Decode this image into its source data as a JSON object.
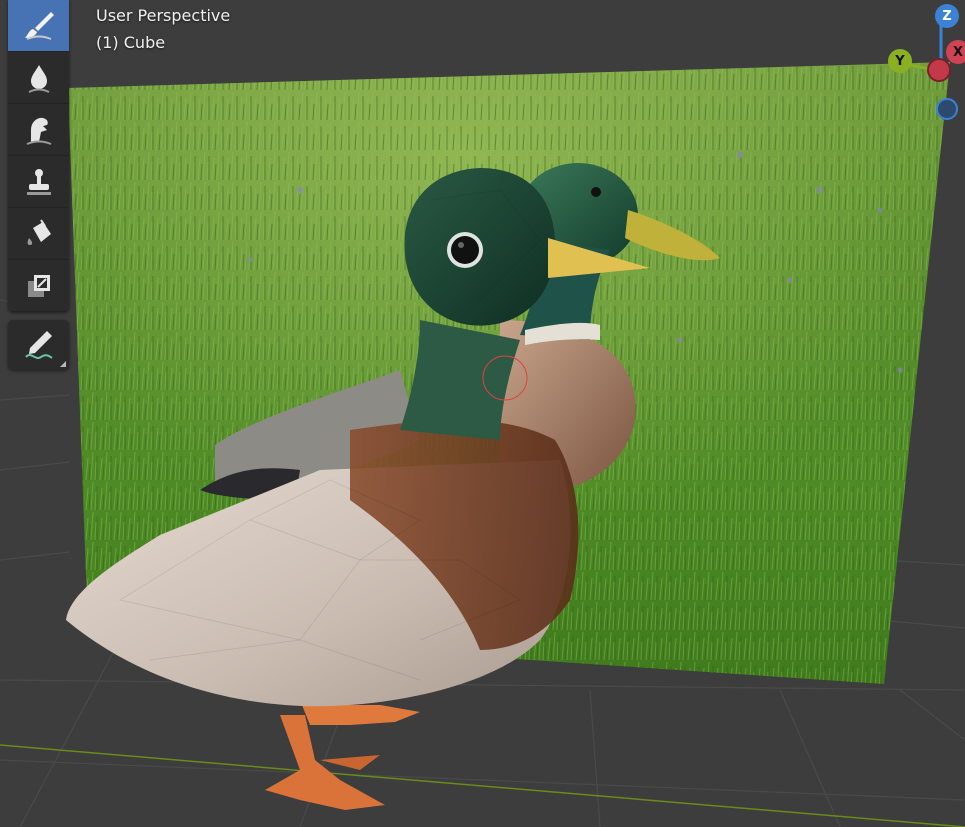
{
  "viewport": {
    "view_name": "User Perspective",
    "object_label": "(1) Cube"
  },
  "toolbar": {
    "tools": [
      {
        "name": "draw-tool",
        "icon": "brush-icon",
        "active": true
      },
      {
        "name": "soften-tool",
        "icon": "drop-icon",
        "active": false
      },
      {
        "name": "smear-tool",
        "icon": "smear-icon",
        "active": false
      },
      {
        "name": "clone-tool",
        "icon": "stamp-icon",
        "active": false
      },
      {
        "name": "fill-tool",
        "icon": "bucket-icon",
        "active": false
      },
      {
        "name": "mask-tool",
        "icon": "mask-icon",
        "active": false
      }
    ],
    "annotate_tool": {
      "name": "annotate-tool",
      "icon": "pencil-annotate-icon"
    }
  },
  "gizmo": {
    "z_label": "Z",
    "y_label": "Y",
    "x_label": "X",
    "colors": {
      "x": "#d14253",
      "y": "#8ab022",
      "z": "#3b82d6",
      "neg_z": "#2d4a6e"
    }
  },
  "colors": {
    "active_tool": "#4772b3",
    "toolbar_bg": "#2b2b2b",
    "viewport_bg": "#3d3d3d",
    "grid_line": "#4a4a4a",
    "x_axis_line": "#7a1f2a",
    "y_axis_line": "#6a8a1a"
  }
}
